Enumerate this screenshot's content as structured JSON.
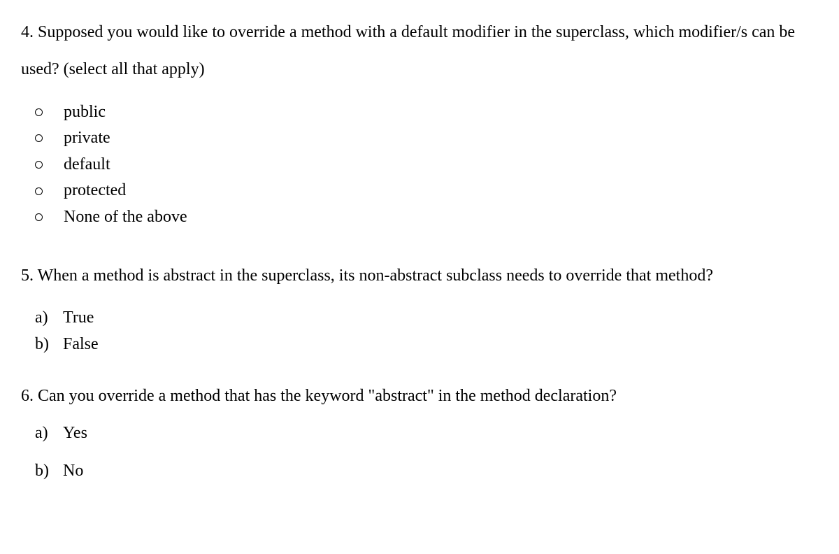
{
  "questions": {
    "q4": {
      "number": "4.",
      "text": "Supposed you would like to override a method with a default modifier in the superclass, which modifier/s can be used? (select all that apply)",
      "options": [
        "public",
        "private",
        "default",
        "protected",
        "None of the above"
      ]
    },
    "q5": {
      "number": "5.",
      "text": "When a method is abstract in the superclass, its non-abstract subclass needs to override that method?",
      "options": [
        {
          "marker": "a)",
          "label": "True"
        },
        {
          "marker": "b)",
          "label": "False"
        }
      ]
    },
    "q6": {
      "number": "6.",
      "text": "Can you override a method that has the keyword \"abstract\" in the method declaration?",
      "options": [
        {
          "marker": "a)",
          "label": "Yes"
        },
        {
          "marker": "b)",
          "label": "No"
        }
      ]
    }
  }
}
